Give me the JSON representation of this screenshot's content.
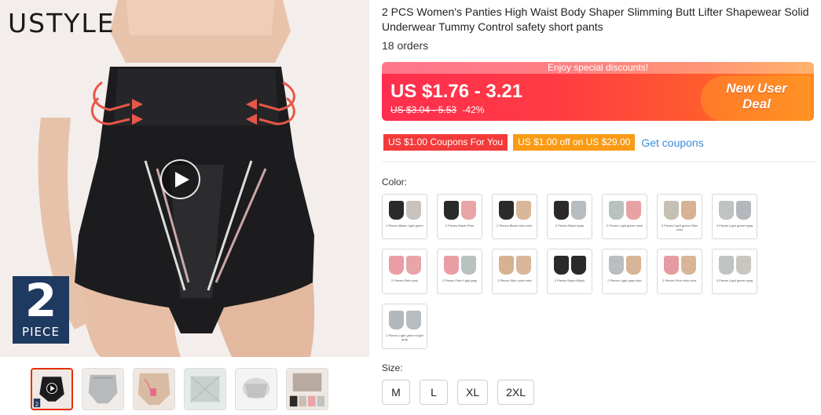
{
  "gallery": {
    "brand_logo": "USTYLE",
    "badge": {
      "number": "2",
      "label": "PIECE"
    },
    "thumbnails": [
      {
        "name": "thumb-1",
        "active": true,
        "badge": "2"
      },
      {
        "name": "thumb-2",
        "active": false
      },
      {
        "name": "thumb-3",
        "active": false
      },
      {
        "name": "thumb-4",
        "active": false
      },
      {
        "name": "thumb-5",
        "active": false
      },
      {
        "name": "thumb-6",
        "active": false
      }
    ]
  },
  "product": {
    "title": "2 PCS Women's Panties High Waist Body Shaper Slimming Butt Lifter Shapewear Solid Underwear Tummy Control safety short pants",
    "orders": "18 orders",
    "price": {
      "banner": "Enjoy special discounts!",
      "current": "US $1.76 - 3.21",
      "original": "US $3.04 - 5.53",
      "discount": "-42%",
      "deal_line1": "New User",
      "deal_line2": "Deal"
    },
    "coupons": {
      "coupon1": "US $1.00 Coupons For You",
      "coupon2": "US $1.00 off on US $29.00",
      "link": "Get coupons"
    },
    "color_label": "Color:",
    "colors": [
      {
        "a": "#2a2a2a",
        "b": "#c8c3bd",
        "caption": "2 Pieces Black Light green"
      },
      {
        "a": "#2a2a2a",
        "b": "#e9a4a8",
        "caption": "2 Pieces Black+Pink"
      },
      {
        "a": "#2a2a2a",
        "b": "#d9b79a",
        "caption": "2 Pieces Black+skin color"
      },
      {
        "a": "#2a2a2a",
        "b": "#b6bcc0",
        "caption": "2 Pieces Black+gray"
      },
      {
        "a": "#b9c2be",
        "b": "#e8a2a6",
        "caption": "2 Pieces Light green+pink"
      },
      {
        "a": "#c4c0b4",
        "b": "#d7b393",
        "caption": "2 Pieces Light green+Skin color"
      },
      {
        "a": "#bfc3c1",
        "b": "#b4b8bc",
        "caption": "2 Pieces Light green+gray"
      },
      {
        "a": "#e89ea4",
        "b": "#e9a4a8",
        "caption": "2 Pieces Pink+pink"
      },
      {
        "a": "#e89ea4",
        "b": "#b9c2be",
        "caption": "2 Pieces Pink+Light gray"
      },
      {
        "a": "#d6b291",
        "b": "#d9b79a",
        "caption": "2 Pieces Skin color+skin"
      },
      {
        "a": "#2a2a2a",
        "b": "#2a2a2a",
        "caption": "2 Pieces Black+Black"
      },
      {
        "a": "#b8bec1",
        "b": "#d8b596",
        "caption": "2 Pieces Light gray+skin"
      },
      {
        "a": "#e59ba1",
        "b": "#d8b596",
        "caption": "2 Pieces Pink+skin color"
      },
      {
        "a": "#bfc3c1",
        "b": "#c9c6bf",
        "caption": "2 Pieces Light green+gray"
      },
      {
        "a": "#b2b8bc",
        "b": "#b6bcc0",
        "caption": "2 Pieces Light green+Light gray"
      }
    ],
    "size_label": "Size:",
    "sizes": [
      "M",
      "L",
      "XL",
      "2XL"
    ]
  },
  "colors": {
    "accent": "#ff3b43",
    "coupon_red": "#f23a3a",
    "coupon_orange": "#f99b14",
    "link": "#3a8ed6",
    "badge_blue": "#1f3a60"
  },
  "icons": {
    "play": "play-icon"
  }
}
